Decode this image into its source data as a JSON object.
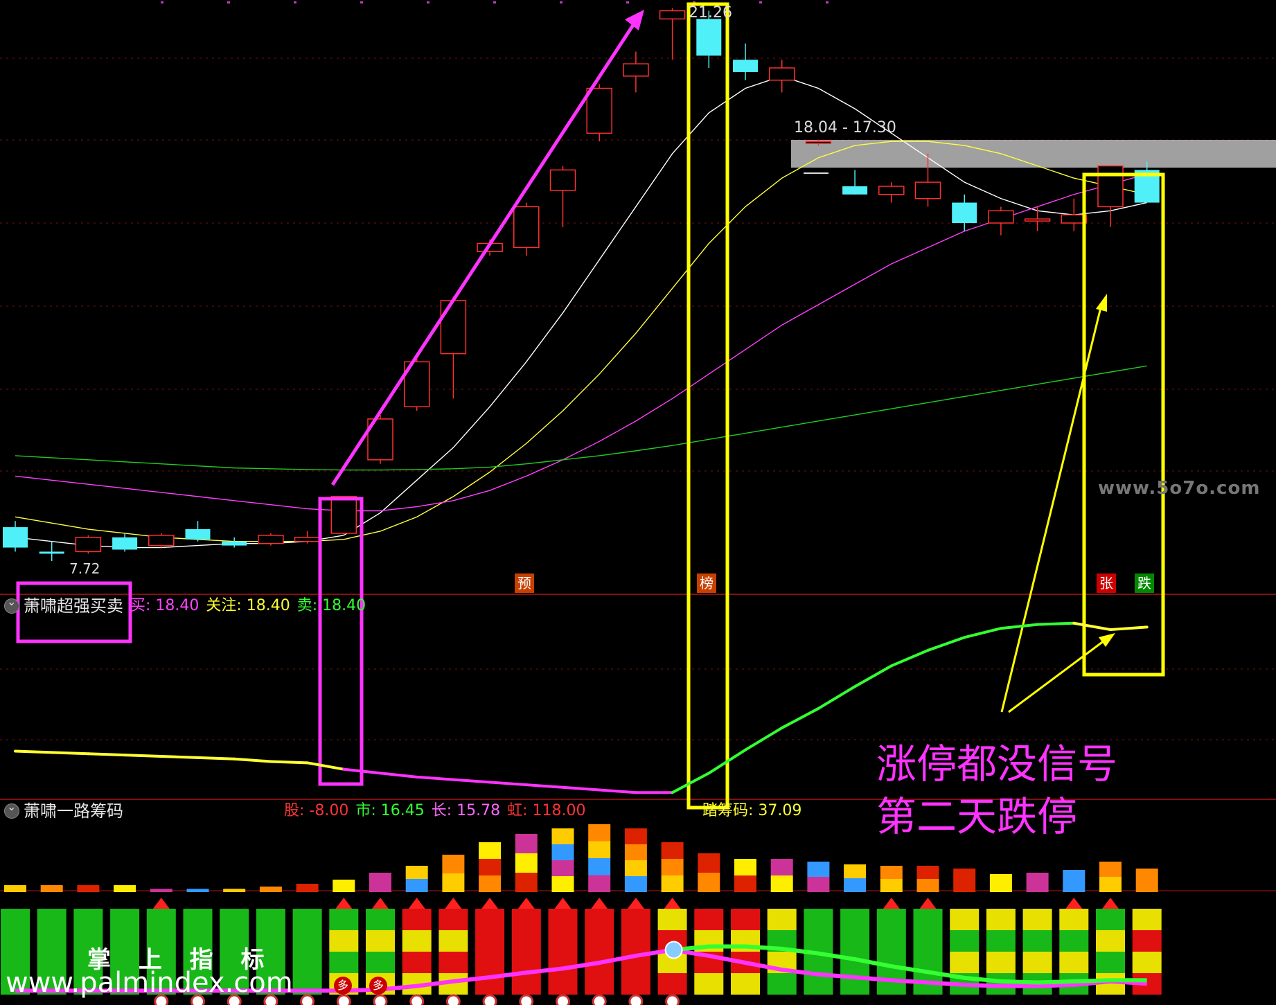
{
  "chart_data": {
    "type": "candlestick",
    "price_labels": {
      "high": "21.26",
      "low": "7.72",
      "range": "18.04 - 17.30"
    },
    "candles": [
      {
        "o": 8.55,
        "c": 8.05,
        "h": 8.7,
        "l": 7.95
      },
      {
        "o": 7.95,
        "c": 7.9,
        "h": 8.2,
        "l": 7.72
      },
      {
        "o": 7.95,
        "c": 8.3,
        "h": 8.35,
        "l": 7.9
      },
      {
        "o": 8.3,
        "c": 8.0,
        "h": 8.4,
        "l": 7.95
      },
      {
        "o": 8.1,
        "c": 8.35,
        "h": 8.4,
        "l": 8.05
      },
      {
        "o": 8.5,
        "c": 8.25,
        "h": 8.7,
        "l": 8.2
      },
      {
        "o": 8.2,
        "c": 8.1,
        "h": 8.3,
        "l": 8.05
      },
      {
        "o": 8.15,
        "c": 8.35,
        "h": 8.4,
        "l": 8.1
      },
      {
        "o": 8.2,
        "c": 8.3,
        "h": 8.45,
        "l": 8.15
      },
      {
        "o": 8.4,
        "c": 9.3,
        "h": 9.3,
        "l": 8.35
      },
      {
        "o": 10.2,
        "c": 11.2,
        "h": 11.3,
        "l": 10.1
      },
      {
        "o": 11.5,
        "c": 12.6,
        "h": 12.7,
        "l": 11.4
      },
      {
        "o": 12.8,
        "c": 14.1,
        "h": 14.2,
        "l": 11.7
      },
      {
        "o": 15.3,
        "c": 15.5,
        "h": 15.6,
        "l": 15.2
      },
      {
        "o": 15.4,
        "c": 16.4,
        "h": 16.5,
        "l": 15.2
      },
      {
        "o": 16.8,
        "c": 17.3,
        "h": 17.4,
        "l": 15.9
      },
      {
        "o": 18.2,
        "c": 19.3,
        "h": 19.4,
        "l": 18.0
      },
      {
        "o": 19.6,
        "c": 19.9,
        "h": 20.2,
        "l": 19.2
      },
      {
        "o": 21.0,
        "c": 21.2,
        "h": 21.26,
        "l": 20.0
      },
      {
        "o": 21.0,
        "c": 20.1,
        "h": 21.2,
        "l": 19.8
      },
      {
        "o": 20.0,
        "c": 19.7,
        "h": 20.4,
        "l": 19.5
      },
      {
        "o": 19.5,
        "c": 19.8,
        "h": 20.0,
        "l": 19.2
      },
      {
        "o": 18.0,
        "c": 18.0,
        "h": 18.04,
        "l": 17.9
      },
      {
        "o": 16.9,
        "c": 16.7,
        "h": 17.3,
        "l": 16.7
      },
      {
        "o": 16.7,
        "c": 16.9,
        "h": 17.0,
        "l": 16.5
      },
      {
        "o": 16.6,
        "c": 17.0,
        "h": 17.7,
        "l": 16.4
      },
      {
        "o": 16.5,
        "c": 16.0,
        "h": 16.7,
        "l": 15.8
      },
      {
        "o": 16.0,
        "c": 16.3,
        "h": 16.4,
        "l": 15.7
      },
      {
        "o": 16.1,
        "c": 16.1,
        "h": 16.4,
        "l": 15.8
      },
      {
        "o": 16.0,
        "c": 16.2,
        "h": 16.6,
        "l": 15.8
      },
      {
        "o": 16.4,
        "c": 17.4,
        "h": 17.4,
        "l": 15.9
      },
      {
        "o": 17.3,
        "c": 16.5,
        "h": 17.5,
        "l": 16.5
      }
    ],
    "ma_lines": [
      {
        "color": "#ffffff",
        "values": [
          8.3,
          8.2,
          8.1,
          8.05,
          8.05,
          8.1,
          8.15,
          8.15,
          8.2,
          8.35,
          8.9,
          9.7,
          10.5,
          11.5,
          12.6,
          13.8,
          15.1,
          16.4,
          17.7,
          18.7,
          19.3,
          19.6,
          19.3,
          18.8,
          18.2,
          17.6,
          17.0,
          16.6,
          16.3,
          16.2,
          16.3,
          16.5
        ]
      },
      {
        "color": "#ffff40",
        "values": [
          8.8,
          8.65,
          8.5,
          8.4,
          8.3,
          8.25,
          8.2,
          8.2,
          8.2,
          8.25,
          8.45,
          8.8,
          9.3,
          9.9,
          10.6,
          11.4,
          12.3,
          13.3,
          14.4,
          15.5,
          16.4,
          17.1,
          17.6,
          17.9,
          18.0,
          18.0,
          17.9,
          17.7,
          17.4,
          17.1,
          16.9,
          16.7
        ]
      },
      {
        "color": "#ff40ff",
        "values": [
          9.8,
          9.7,
          9.6,
          9.5,
          9.4,
          9.3,
          9.2,
          9.1,
          9.0,
          8.95,
          8.95,
          9.05,
          9.2,
          9.45,
          9.8,
          10.2,
          10.65,
          11.15,
          11.7,
          12.3,
          12.9,
          13.5,
          14.0,
          14.5,
          15.0,
          15.4,
          15.8,
          16.1,
          16.4,
          16.7,
          16.95,
          17.2
        ]
      },
      {
        "color": "#22cc22",
        "values": [
          10.3,
          10.25,
          10.2,
          10.15,
          10.1,
          10.05,
          10.0,
          9.98,
          9.96,
          9.95,
          9.95,
          9.96,
          9.98,
          10.02,
          10.1,
          10.2,
          10.3,
          10.42,
          10.55,
          10.7,
          10.85,
          11.0,
          11.15,
          11.3,
          11.45,
          11.6,
          11.75,
          11.9,
          12.05,
          12.2,
          12.35,
          12.5
        ]
      }
    ],
    "signal_markers": [
      "预",
      "榜",
      "张",
      "跌"
    ],
    "panel2": {
      "title": "萧啸超强买卖",
      "fields": [
        {
          "label": "买",
          "value": "18.40",
          "color": "#ff44ff"
        },
        {
          "label": "关注",
          "value": "18.40",
          "color": "#ffff33"
        },
        {
          "label": "卖",
          "value": "18.40",
          "color": "#33ff33"
        }
      ],
      "line": [
        18.2,
        18.1,
        18.0,
        17.9,
        17.8,
        17.7,
        17.6,
        17.4,
        17.3,
        16.8,
        16.5,
        16.2,
        16.0,
        15.8,
        15.6,
        15.4,
        15.2,
        15.0,
        15.0,
        16.5,
        18.3,
        20.0,
        21.5,
        23.2,
        24.8,
        26.0,
        27.0,
        27.7,
        28.0,
        28.1,
        27.6,
        27.8
      ],
      "line_segment_colors": [
        "#ffff33",
        "#ff33ff",
        "#33ff33"
      ]
    },
    "panel3": {
      "title": "萧啸一路筹码",
      "fields": [
        {
          "label": "股",
          "value": "-8.00",
          "color": "#ff3333"
        },
        {
          "label": "市",
          "value": "16.45",
          "color": "#33ff33"
        },
        {
          "label": "长",
          "value": "15.78",
          "color": "#ff66ff"
        },
        {
          "label": "虹",
          "value": "118.00",
          "color": "#ff3333"
        },
        {
          "label": "踏筹码",
          "value": "37.09",
          "color": "#ffff33"
        }
      ],
      "upper_bar_heights": [
        0.25,
        0.25,
        0.25,
        0.25,
        0.12,
        0.12,
        0.12,
        0.2,
        0.3,
        0.45,
        0.7,
        0.95,
        1.35,
        1.8,
        2.1,
        2.3,
        2.45,
        2.3,
        1.8,
        1.4,
        1.2,
        1.2,
        1.1,
        1.0,
        0.95,
        0.95,
        0.85,
        0.65,
        0.7,
        0.8,
        1.1,
        0.85
      ],
      "lower_bar_kind": [
        "g",
        "g",
        "g",
        "g",
        "g",
        "g",
        "g",
        "g",
        "g",
        "gy",
        "gy",
        "ry",
        "ry",
        "r",
        "r",
        "r",
        "r",
        "r",
        "yr",
        "ry",
        "ry",
        "yg",
        "g",
        "g",
        "g",
        "g",
        "yg",
        "yg",
        "yg",
        "yg",
        "gy",
        "yr"
      ],
      "pink_line": [
        0.02,
        0.02,
        0.02,
        0.02,
        0.02,
        0.02,
        0.02,
        0.02,
        0.02,
        0.02,
        0.04,
        0.1,
        0.18,
        0.25,
        0.33,
        0.4,
        0.5,
        0.62,
        0.72,
        0.62,
        0.5,
        0.38,
        0.3,
        0.25,
        0.2,
        0.16,
        0.12,
        0.1,
        0.1,
        0.12,
        0.18,
        0.14
      ],
      "green_line": [
        null,
        null,
        null,
        null,
        null,
        null,
        null,
        null,
        null,
        null,
        null,
        null,
        null,
        null,
        null,
        null,
        null,
        null,
        0.72,
        0.78,
        0.78,
        0.74,
        0.66,
        0.56,
        0.44,
        0.34,
        0.24,
        0.18,
        0.16,
        0.18,
        0.2,
        0.2
      ]
    }
  },
  "annotations": {
    "line1": "涨停都没信号",
    "line2": "第二天跌停"
  },
  "watermark_right": "www.5o7o.com",
  "watermark_left_title": "掌 上 指 标",
  "watermark_left_url": "www.palmindex.com",
  "bottom_signals": [
    "多",
    "多"
  ]
}
